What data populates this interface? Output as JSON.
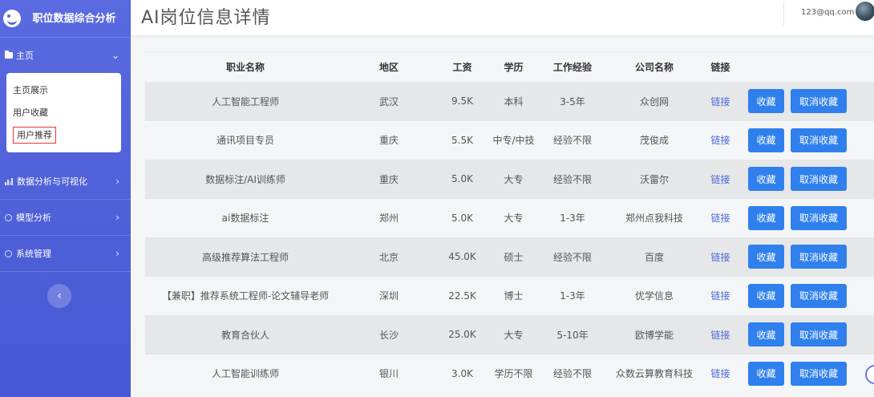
{
  "sidebar": {
    "brand_title": "职位数据综合分析",
    "menus": [
      {
        "label": "主页",
        "icon": "folder-icon",
        "expanded": true
      },
      {
        "label": "数据分析与可视化",
        "icon": "bar-chart-icon"
      },
      {
        "label": "模型分析",
        "icon": "gear-icon"
      },
      {
        "label": "系统管理",
        "icon": "gear-icon"
      }
    ],
    "submenu": [
      "主页展示",
      "用户收藏",
      "用户推荐"
    ],
    "active_submenu": "用户推荐",
    "collapse_symbol": "‹"
  },
  "header": {
    "title": "AI岗位信息详情",
    "user_email": "123@qq.com"
  },
  "table": {
    "columns": [
      "职业名称",
      "地区",
      "工资",
      "学历",
      "工作经验",
      "公司名称",
      "链接"
    ],
    "rows": [
      {
        "name": "人工智能工程师",
        "city": "武汉",
        "salary": "9.5K",
        "edu": "本科",
        "exp": "3-5年",
        "company": "众创网",
        "link": "链接"
      },
      {
        "name": "通讯项目专员",
        "city": "重庆",
        "salary": "5.5K",
        "edu": "中专/中技",
        "exp": "经验不限",
        "company": "茂俊成",
        "link": "链接"
      },
      {
        "name": "数据标注/AI训练师",
        "city": "重庆",
        "salary": "5.0K",
        "edu": "大专",
        "exp": "经验不限",
        "company": "沃雷尔",
        "link": "链接"
      },
      {
        "name": "ai数据标注",
        "city": "郑州",
        "salary": "5.0K",
        "edu": "大专",
        "exp": "1-3年",
        "company": "郑州点我科技",
        "link": "链接"
      },
      {
        "name": "高级推荐算法工程师",
        "city": "北京",
        "salary": "45.0K",
        "edu": "硕士",
        "exp": "经验不限",
        "company": "百度",
        "link": "链接"
      },
      {
        "name": "【兼职】推荐系统工程师-论文辅导老师",
        "city": "深圳",
        "salary": "22.5K",
        "edu": "博士",
        "exp": "1-3年",
        "company": "优学信息",
        "link": "链接"
      },
      {
        "name": "教育合伙人",
        "city": "长沙",
        "salary": "25.0K",
        "edu": "大专",
        "exp": "5-10年",
        "company": "欧博学能",
        "link": "链接"
      },
      {
        "name": "人工智能训练师",
        "city": "银川",
        "salary": "3.0K",
        "edu": "学历不限",
        "exp": "经验不限",
        "company": "众数云算教育科技",
        "link": "链接"
      }
    ],
    "fav_label": "收藏",
    "unfav_label": "取消收藏"
  },
  "colors": {
    "sidebar": "#5263dc",
    "button": "#2f80ed",
    "link": "#4a67d6",
    "active_outline": "#e53935"
  }
}
